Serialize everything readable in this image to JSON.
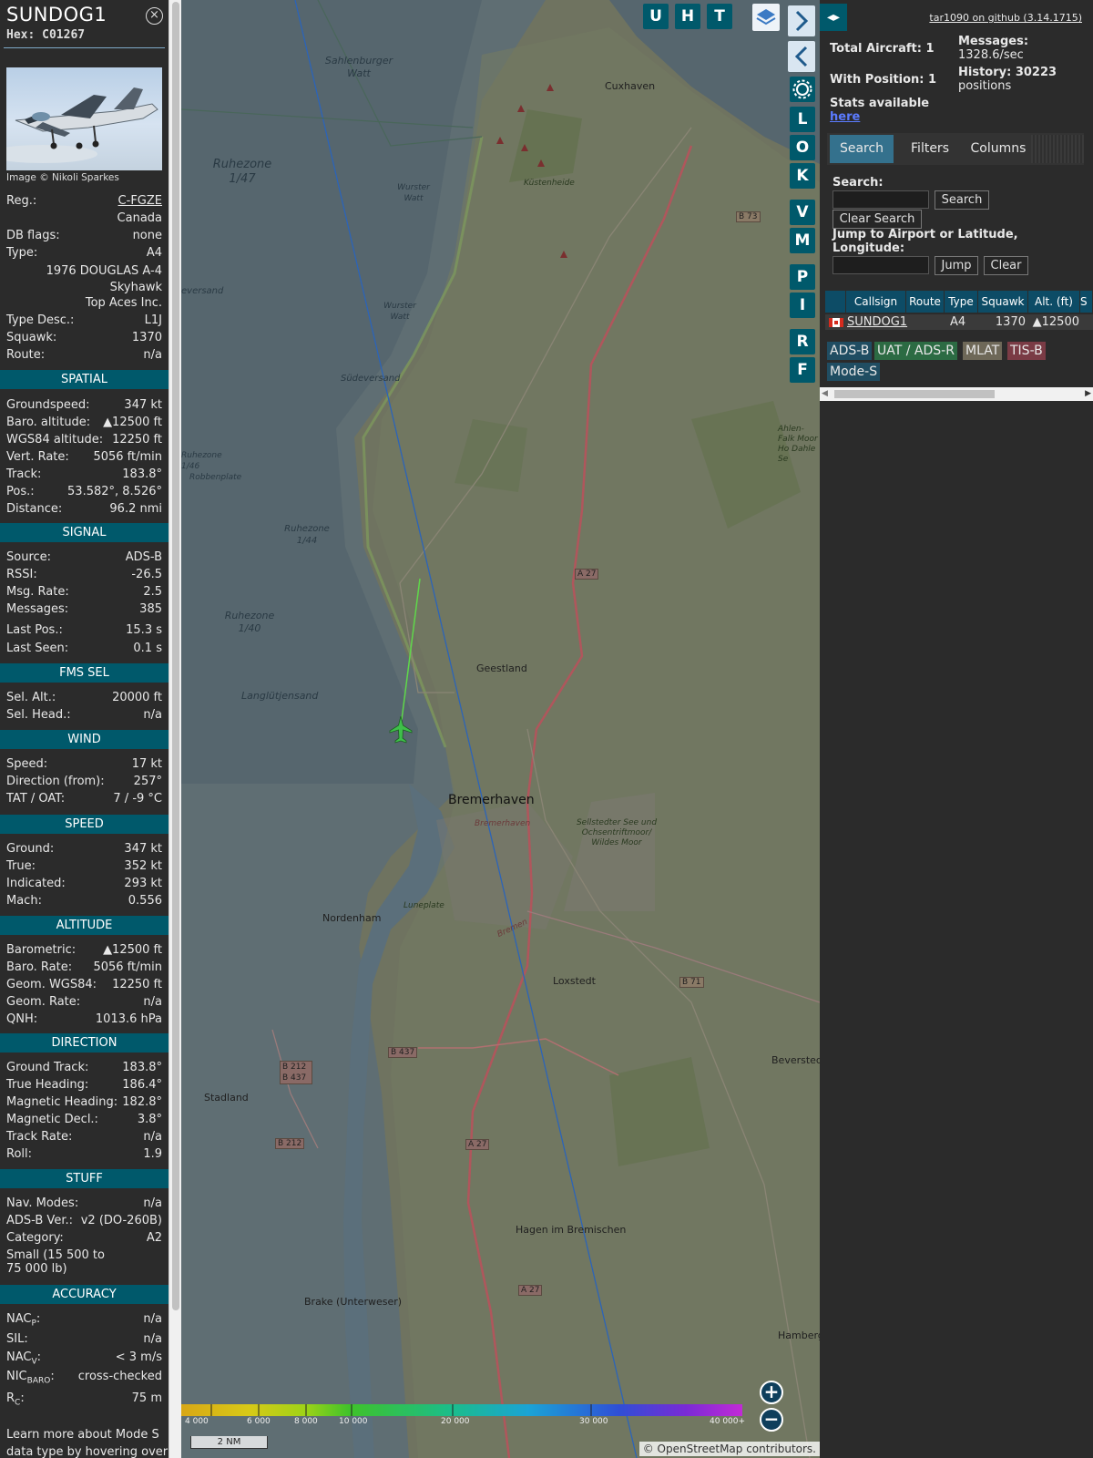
{
  "info": {
    "callsign": "SUNDOG1",
    "hex": "Hex: C01267",
    "close_icon": "×",
    "image_credit": "Image © Nikoli Sparkes",
    "general": [
      {
        "key": "Reg.:",
        "value": "C-FGZE"
      },
      {
        "key": "",
        "value": "Canada"
      },
      {
        "key": "DB flags:",
        "value": "none"
      },
      {
        "key": "Type:",
        "value": "A4"
      },
      {
        "key": "",
        "value": "1976 DOUGLAS A-4 Skyhawk"
      },
      {
        "key": "",
        "value": "Top Aces Inc."
      },
      {
        "key": "Type Desc.:",
        "value": "L1J"
      },
      {
        "key": "Squawk:",
        "value": "1370"
      },
      {
        "key": "Route:",
        "value": "n/a"
      }
    ],
    "sections": {
      "spatial": {
        "title": "SPATIAL",
        "rows": [
          {
            "key": "Groundspeed:",
            "value": "347 kt"
          },
          {
            "key": "Baro. altitude:",
            "value": "▲12500 ft"
          },
          {
            "key": "WGS84 altitude:",
            "value": "12250 ft"
          },
          {
            "key": "Vert. Rate:",
            "value": "5056 ft/min"
          },
          {
            "key": "Track:",
            "value": "183.8°"
          },
          {
            "key": "Pos.:",
            "value": "53.582°, 8.526°"
          },
          {
            "key": "Distance:",
            "value": "96.2 nmi"
          }
        ]
      },
      "signal": {
        "title": "SIGNAL",
        "rows": [
          {
            "key": "Source:",
            "value": "ADS-B"
          },
          {
            "key": "RSSI:",
            "value": "-26.5"
          },
          {
            "key": "Msg. Rate:",
            "value": "2.5"
          },
          {
            "key": "Messages:",
            "value": "385"
          },
          {
            "key": "Last Pos.:",
            "value": "15.3 s"
          },
          {
            "key": "Last Seen:",
            "value": "0.1 s"
          }
        ]
      },
      "fms": {
        "title": "FMS SEL",
        "rows": [
          {
            "key": "Sel. Alt.:",
            "value": "20000 ft"
          },
          {
            "key": "Sel. Head.:",
            "value": "n/a"
          }
        ]
      },
      "wind": {
        "title": "WIND",
        "rows": [
          {
            "key": "Speed:",
            "value": "17 kt"
          },
          {
            "key": "Direction (from):",
            "value": "257°"
          },
          {
            "key": "TAT / OAT:",
            "value": "7 / -9 °C"
          }
        ]
      },
      "speed": {
        "title": "SPEED",
        "rows": [
          {
            "key": "Ground:",
            "value": "347 kt"
          },
          {
            "key": "True:",
            "value": "352 kt"
          },
          {
            "key": "Indicated:",
            "value": "293 kt"
          },
          {
            "key": "Mach:",
            "value": "0.556"
          }
        ]
      },
      "altitude": {
        "title": "ALTITUDE",
        "rows": [
          {
            "key": "Barometric:",
            "value": "▲12500 ft"
          },
          {
            "key": "Baro. Rate:",
            "value": "5056 ft/min"
          },
          {
            "key": "Geom. WGS84:",
            "value": "12250 ft"
          },
          {
            "key": "Geom. Rate:",
            "value": "n/a"
          },
          {
            "key": "QNH:",
            "value": "1013.6 hPa"
          }
        ]
      },
      "direction": {
        "title": "DIRECTION",
        "rows": [
          {
            "key": "Ground Track:",
            "value": "183.8°"
          },
          {
            "key": "True Heading:",
            "value": "186.4°"
          },
          {
            "key": "Magnetic Heading:",
            "value": "182.8°"
          },
          {
            "key": "Magnetic Decl.:",
            "value": "3.8°"
          },
          {
            "key": "Track Rate:",
            "value": "n/a"
          },
          {
            "key": "Roll:",
            "value": "1.9"
          }
        ]
      },
      "stuff": {
        "title": "STUFF",
        "rows": [
          {
            "key": "Nav. Modes:",
            "value": "n/a"
          },
          {
            "key": "ADS-B Ver.:",
            "value": "v2 (DO-260B)"
          },
          {
            "key": "Category:",
            "value": "A2"
          }
        ],
        "category_desc": "Small (15 500 to 75 000 lb)"
      },
      "accuracy": {
        "title": "ACCURACY",
        "nacp_key": "NAC",
        "nacp_sub": "P",
        "nacp_value": "n/a",
        "sil_key": "SIL:",
        "sil_value": "n/a",
        "nacv_key": "NAC",
        "nacv_sub": "V",
        "nacv_value": "< 3 m/s",
        "nic_key": "NIC",
        "nic_sub": "BARO",
        "nic_value": "cross-checked",
        "rc_key": "R",
        "rc_sub": "C",
        "rc_value": "75 m"
      }
    },
    "footer_note": "Learn more about Mode S data type by hovering over"
  },
  "map": {
    "buttons": {
      "u": "U",
      "h": "H",
      "t": "T",
      "layers_icon": "layers-icon",
      "next": "›",
      "prev": "‹",
      "settings_icon": "gear-icon",
      "l": "L",
      "o": "O",
      "k": "K",
      "v": "V",
      "m": "M",
      "p": "P",
      "i": "I",
      "r": "R",
      "f": "F"
    },
    "zoom_in": "+",
    "zoom_out": "−",
    "scale": "2 NM",
    "attribution": "© OpenStreetMap contributors.",
    "altitude_labels": [
      "4 000",
      "6 000",
      "8 000",
      "10 000",
      "20 000",
      "30 000",
      "40 000+"
    ],
    "place_labels": {
      "cuxhaven": "Cuxhaven",
      "sahlenburger": "Sahlenburger Watt",
      "ruhezone147": "Ruhezone 1/47",
      "ruhezone146": "Ruhezone 1/46",
      "ruhezone144": "Ruhezone 1/44",
      "ruhezone140": "Ruhezone 1/40",
      "kustenheide": "Küstenheide",
      "wurster_watt1": "Wurster Watt",
      "wurster_watt2": "Wurster Watt",
      "evers": "eversand",
      "sudeversand": "Südeversand",
      "robbenplate": "Robbenplate",
      "langlutjen": "Langlütjensand",
      "geestland": "Geestland",
      "bremerhaven": "Bremerhaven",
      "bremerhaven_small": "Bremerhaven",
      "nordenham": "Nordenham",
      "luneplate": "Luneplate",
      "bremen_sm": "Bremen",
      "loxstedt": "Loxstedt",
      "stadland": "Stadland",
      "beverstedt": "Beverstedt",
      "hagen": "Hagen im Bremischen",
      "brake": "Brake (Unterweser)",
      "hamberg": "Hamberg",
      "sellstedt": "Sellstedter See und Ochsentriftmoor/ Wildes Moor",
      "ahlen": "Ahlen-Falk Moor Ho Dahle Se"
    },
    "road_labels": {
      "b73": "B 73",
      "a27a": "A 27",
      "a27b": "A 27",
      "a27c": "A 27",
      "b71": "B 71",
      "b437": "B 437",
      "b212": "B 212",
      "b212b437": "B 212 B 437"
    }
  },
  "sidebar": {
    "toggle_icon": "◂▸",
    "version_link": "tar1090 on github (3.14.1715)",
    "total_label": "Total Aircraft: 1",
    "messages_label": "Messages:",
    "messages_value": "1328.6/sec",
    "position_label": "With Position: 1",
    "history_label": "History: 30223",
    "history_value": "positions",
    "stats_label": "Stats available",
    "stats_link": "here",
    "tabs": [
      "Search",
      "Filters",
      "Columns"
    ],
    "search_label": "Search:",
    "search_button": "Search",
    "clear_search_button": "Clear Search",
    "jump_label": "Jump to Airport or Latitude, Longitude:",
    "jump_button": "Jump",
    "clear_button": "Clear",
    "search_value": "",
    "jump_value": "",
    "table": {
      "columns": [
        "Callsign",
        "Route",
        "Type",
        "Squawk",
        "Alt. (ft)",
        "S"
      ],
      "rows": [
        {
          "flag": "Canada",
          "callsign": "SUNDOG1",
          "route": "",
          "type": "A4",
          "squawk": "1370",
          "alt": "▲12500"
        }
      ]
    },
    "legend": {
      "adsb": "ADS-B",
      "uat": "UAT / ADS-R",
      "mlat": "MLAT",
      "tisb": "TIS-B",
      "modes": "Mode-S"
    },
    "colors": {
      "adsb": "#204d62",
      "uat": "#2c6b43",
      "mlat": "#6e6858",
      "tisb": "#7a3b45",
      "modes": "#204d62"
    }
  }
}
